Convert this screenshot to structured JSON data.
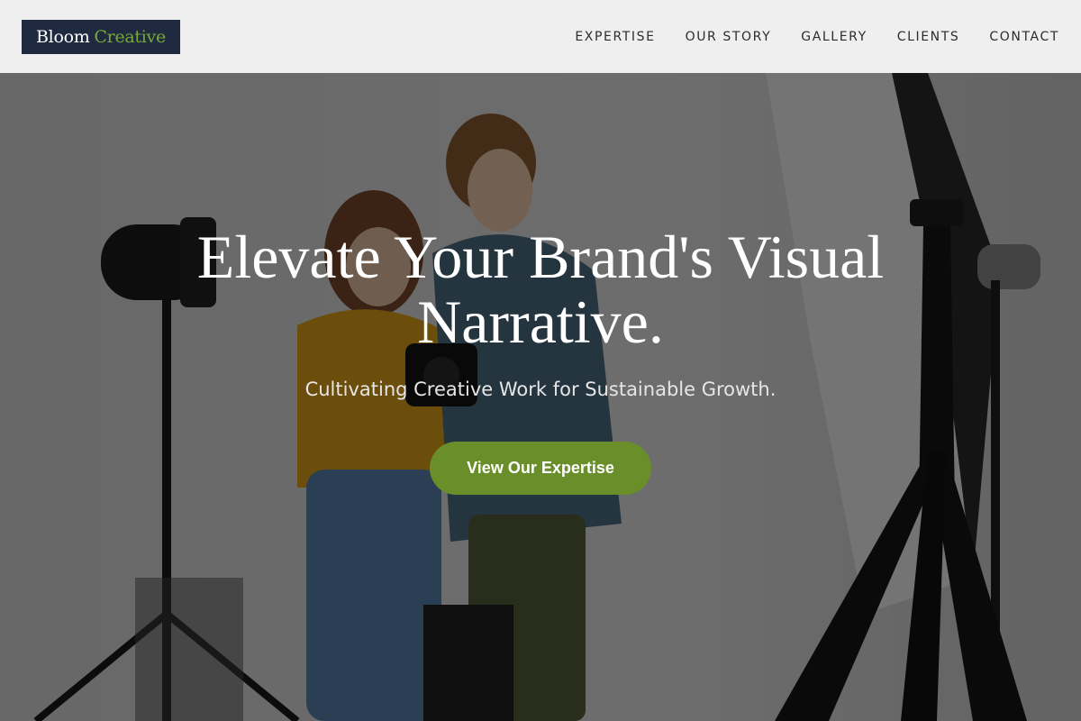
{
  "brand": {
    "name_primary": "Bloom",
    "name_accent": "Creative"
  },
  "nav": {
    "items": [
      {
        "label": "EXPERTISE"
      },
      {
        "label": "OUR STORY"
      },
      {
        "label": "GALLERY"
      },
      {
        "label": "CLIENTS"
      },
      {
        "label": "CONTACT"
      }
    ]
  },
  "hero": {
    "title": "Elevate Your Brand's Visual Narrative.",
    "subtitle": "Cultivating Creative Work for Sustainable Growth.",
    "cta_label": "View Our Expertise"
  },
  "colors": {
    "header_bg": "#efefef",
    "logo_bg": "#1f2a40",
    "logo_accent": "#7aa83a",
    "cta_bg": "#6a8f2a",
    "overlay": "rgba(0,0,0,0.52)"
  },
  "icons": [
    "studio-light-icon",
    "softbox-icon",
    "tripod-icon",
    "camera-icon"
  ]
}
